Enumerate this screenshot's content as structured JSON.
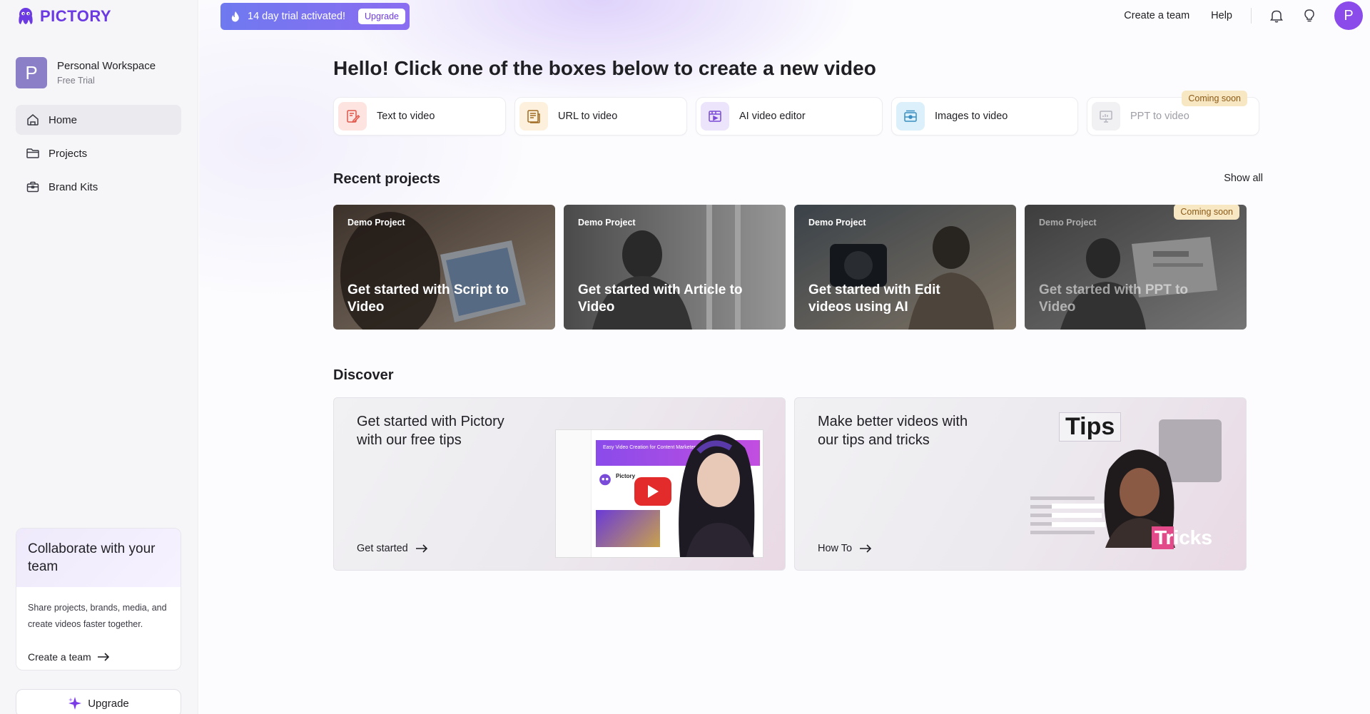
{
  "brand": {
    "name": "PICTORY"
  },
  "workspace": {
    "initial": "P",
    "name": "Personal Workspace",
    "plan": "Free Trial"
  },
  "sidebar": {
    "items": [
      {
        "label": "Home",
        "active": true
      },
      {
        "label": "Projects",
        "active": false
      },
      {
        "label": "Brand Kits",
        "active": false
      }
    ],
    "collab": {
      "title": "Collaborate with your team",
      "body": "Share projects, brands, media, and create videos faster together.",
      "link": "Create a team"
    },
    "upgrade_label": "Upgrade"
  },
  "trial": {
    "text": "14 day trial activated!",
    "button": "Upgrade"
  },
  "topnav": {
    "create_team": "Create a team",
    "help": "Help",
    "avatar_initial": "P"
  },
  "hero": {
    "title": "Hello! Click one of the boxes below to create a new video"
  },
  "create_options": [
    {
      "label": "Text to video",
      "icon": "text-doc-icon",
      "color": "#fde4e0"
    },
    {
      "label": "URL to video",
      "icon": "article-icon",
      "color": "#fdf0dc"
    },
    {
      "label": "AI video editor",
      "icon": "video-editor-icon",
      "color": "#ece4fb"
    },
    {
      "label": "Images to video",
      "icon": "images-icon",
      "color": "#dcf0fb"
    },
    {
      "label": "PPT to video",
      "icon": "presentation-icon",
      "color": "#f1f1f4",
      "badge": "Coming soon"
    }
  ],
  "recent": {
    "title": "Recent projects",
    "show_all": "Show all",
    "projects": [
      {
        "label": "Demo Project",
        "title": "Get started with Script to Video"
      },
      {
        "label": "Demo Project",
        "title": "Get started with Article to Video"
      },
      {
        "label": "Demo Project",
        "title": "Get started with Edit videos using AI"
      },
      {
        "label": "Demo Project",
        "title": "Get started with PPT to Video",
        "badge": "Coming soon"
      }
    ]
  },
  "discover": {
    "title": "Discover",
    "cards": [
      {
        "title": "Get started with Pictory with our free tips",
        "link": "Get started",
        "thumb": {
          "brand": "Pictory",
          "headline": "Easy Video Creation for Content Marketers"
        }
      },
      {
        "title": "Make better videos with our tips and tricks",
        "link": "How To",
        "thumb": {
          "word1": "Tips",
          "word2": "Tricks"
        }
      }
    ]
  },
  "colors": {
    "accent": "#6b3ae3",
    "banner": "#7673f0",
    "badge": "#f8e7c3"
  }
}
